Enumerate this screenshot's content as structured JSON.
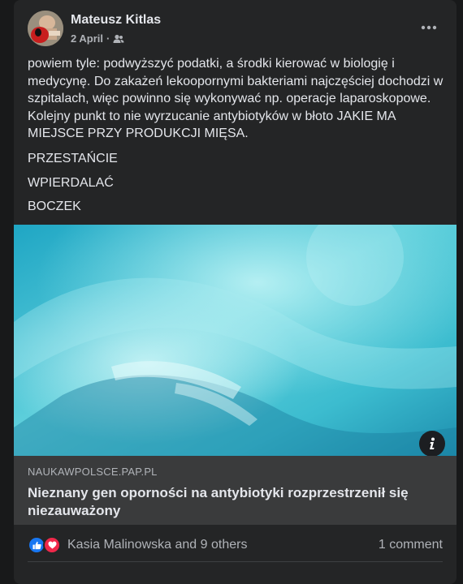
{
  "post": {
    "author": "Mateusz Kitlas",
    "date": "2 April",
    "separator": "·",
    "paragraphs": [
      "powiem tyle: podwyższyć podatki, a środki kierować w biologię i medycynę. Do zakażeń lekoopornymi bakteriami najczęściej dochodzi w szpitalach, więc powinno się wykonywać np. operacje laparoskopowe. Kolejny punkt to nie wyrzucanie antybiotyków w błoto JAKIE MA MIEJSCE PRZY PRODUKCJI MIĘSA.",
      "PRZESTAŃCIE",
      "WPIERDALAĆ",
      "BOCZEK"
    ]
  },
  "link": {
    "domain": "NAUKAWPOLSCE.PAP.PL",
    "title": "Nieznany gen oporności na antybiotyki rozprzestrzenił się niezauważony"
  },
  "footer": {
    "reactions_text": "Kasia Malinowska and 9 others",
    "comments_text": "1 comment"
  },
  "icons": {
    "audience": "friends-icon",
    "more": "more-options-icon",
    "info": "info-icon",
    "like": "like-reaction-icon",
    "love": "love-reaction-icon"
  },
  "colors": {
    "background": "#18191a",
    "card": "#242526",
    "link_box": "#3a3b3c",
    "text_primary": "#e4e6eb",
    "text_secondary": "#b0b3b8",
    "like": "#1877f2",
    "love": "#f0284a"
  }
}
